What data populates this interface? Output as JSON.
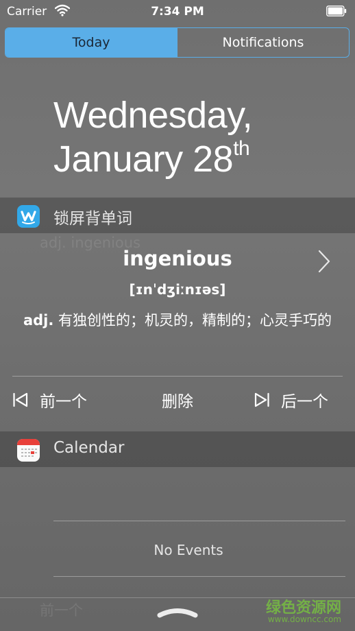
{
  "status_bar": {
    "carrier": "Carrier",
    "time": "7:34 PM"
  },
  "segmented": {
    "today": "Today",
    "notifications": "Notifications"
  },
  "date": {
    "line1": "Wednesday,",
    "line2": "January 28",
    "suffix": "th"
  },
  "words_widget": {
    "app_name": "锁屏背单词",
    "word": "ingenious",
    "phonetic": "[ɪnˈdʒiːnɪəs]",
    "pos": "adj.",
    "meaning": "有独创性的；机灵的，精制的；心灵手巧的",
    "actions": {
      "prev": "前一个",
      "delete": "删除",
      "next": "后一个"
    }
  },
  "calendar_widget": {
    "app_name": "Calendar",
    "no_events": "No Events"
  },
  "watermark": {
    "cn": "绿色资源网",
    "url": "www.downcc.com"
  },
  "colors": {
    "accent": "#5aaee8",
    "words_icon": "#32a8e8",
    "calendar_red": "#e8403a"
  }
}
